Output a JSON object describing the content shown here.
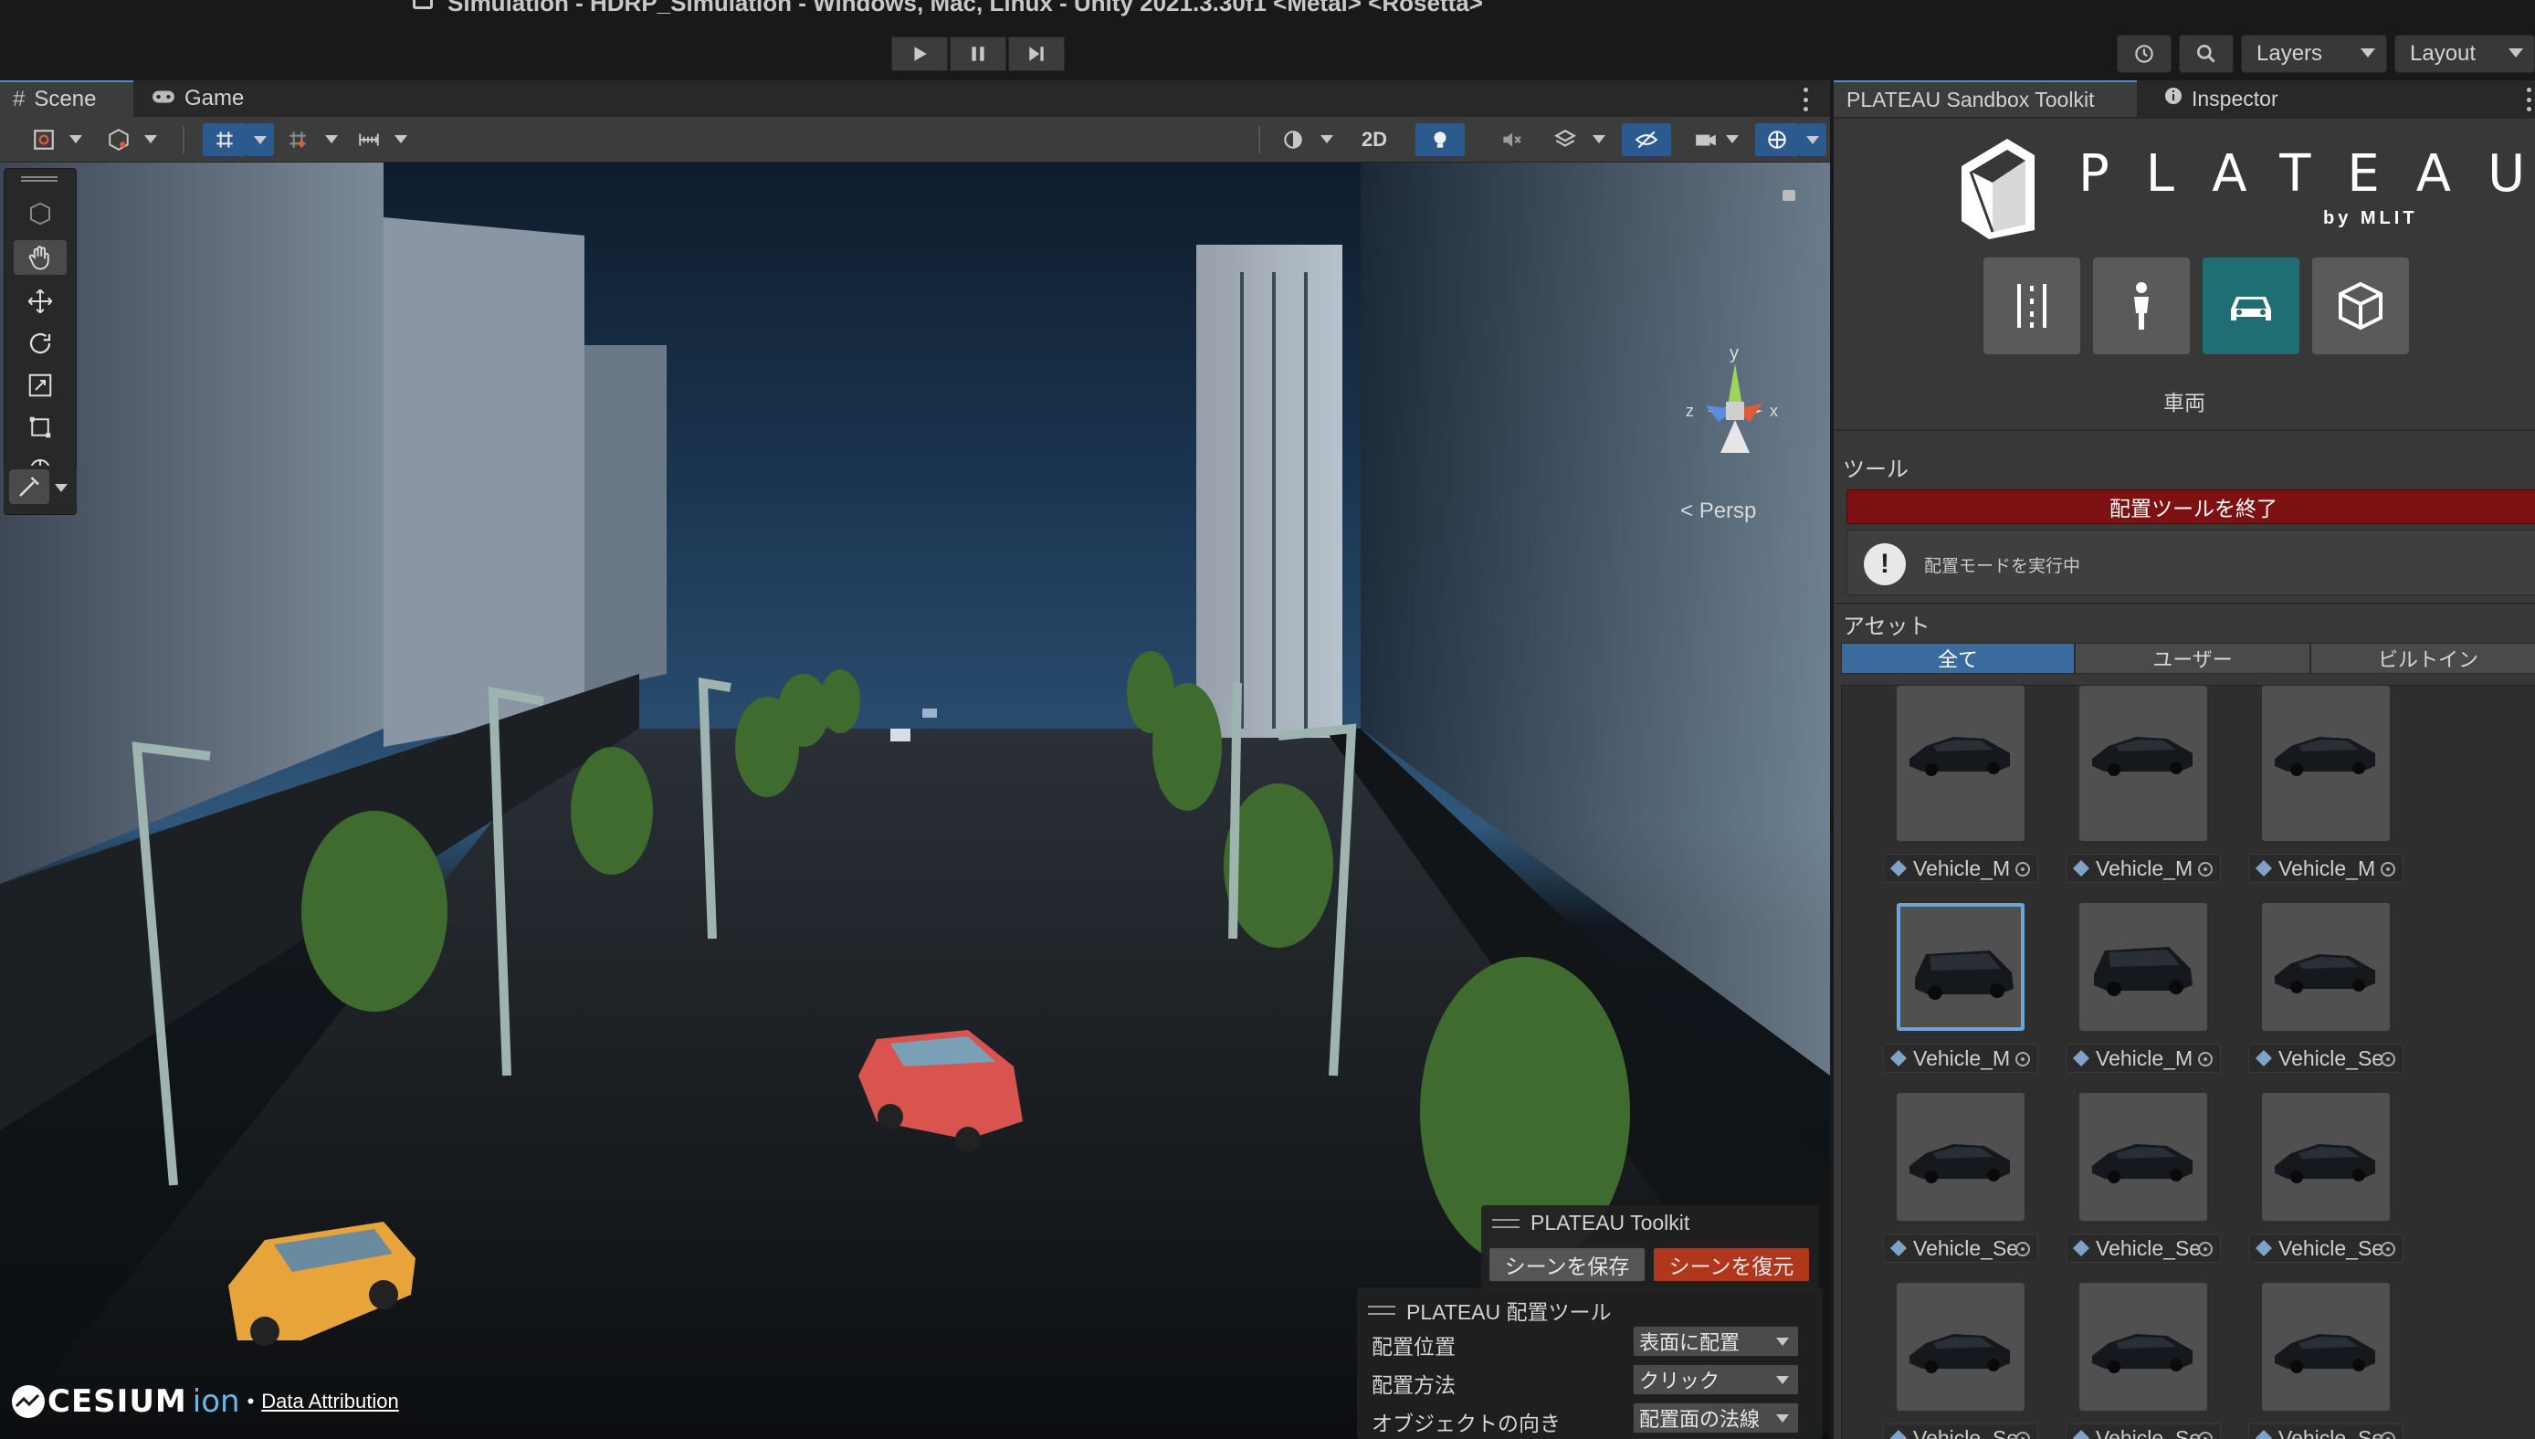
{
  "window": {
    "title": "Simulation - HDRP_Simulation - Windows, Mac, Linux - Unity 2021.3.30f1 <Metal> <Rosetta>"
  },
  "top_right": {
    "layers": "Layers",
    "layout": "Layout"
  },
  "scene_tabs": [
    {
      "label": "Scene",
      "icon": "grid-icon"
    },
    {
      "label": "Game",
      "icon": "gamepad-icon"
    }
  ],
  "scene_toolbar": {
    "mode_2d": "2D"
  },
  "viewport": {
    "projection": "Persp",
    "axis_y": "y",
    "axis_x": "x",
    "axis_z": "z"
  },
  "toolkit_overlay": {
    "title": "PLATEAU Toolkit",
    "save_scene": "シーンを保存",
    "restore_scene": "シーンを復元"
  },
  "placement_overlay": {
    "title": "PLATEAU 配置ツール",
    "rows": [
      {
        "label": "配置位置",
        "value": "表面に配置"
      },
      {
        "label": "配置方法",
        "value": "クリック"
      },
      {
        "label": "オブジェクトの向き",
        "value": "配置面の法線"
      }
    ]
  },
  "attribution": {
    "brand": "CESIUM",
    "brand_suffix": "ion",
    "separator": "•",
    "link": "Data Attribution"
  },
  "right_tabs": [
    {
      "label": "PLATEAU Sandbox Toolkit"
    },
    {
      "label": "Inspector",
      "icon": "info-icon"
    }
  ],
  "plateau": {
    "logo_text": "PLATEAU",
    "logo_sub": "by MLIT"
  },
  "categories": [
    {
      "name": "track",
      "icon": "track-icon"
    },
    {
      "name": "human",
      "icon": "person-icon"
    },
    {
      "name": "vehicle",
      "icon": "car-icon",
      "selected": true
    },
    {
      "name": "prop",
      "icon": "box-icon"
    }
  ],
  "category_label": "車両",
  "tools": {
    "section": "ツール",
    "end_button": "配置ツールを終了",
    "help_text": "配置モードを実行中"
  },
  "assets": {
    "section": "アセット",
    "filters": [
      "全て",
      "ユーザー",
      "ビルトイン"
    ],
    "selected_filter": "全て",
    "items": [
      {
        "label": "Vehicle_M",
        "kind": "van"
      },
      {
        "label": "Vehicle_M",
        "kind": "van"
      },
      {
        "label": "Vehicle_M",
        "kind": "van"
      },
      {
        "label": "Vehicle_M",
        "kind": "van",
        "selected": true
      },
      {
        "label": "Vehicle_M",
        "kind": "van"
      },
      {
        "label": "Vehicle_Se",
        "kind": "sedan"
      },
      {
        "label": "Vehicle_Se",
        "kind": "sedan"
      },
      {
        "label": "Vehicle_Se",
        "kind": "sedan"
      },
      {
        "label": "Vehicle_Se",
        "kind": "sedan"
      },
      {
        "label": "Vehicle_Se",
        "kind": "sedan"
      },
      {
        "label": "Vehicle_Se",
        "kind": "sedan"
      },
      {
        "label": "Vehicle_Se",
        "kind": "sedan"
      }
    ]
  },
  "colors": {
    "accent": "#2b5a8e",
    "danger": "#7d1010",
    "restore": "#b0371b",
    "selected_category": "#1f6e74"
  }
}
